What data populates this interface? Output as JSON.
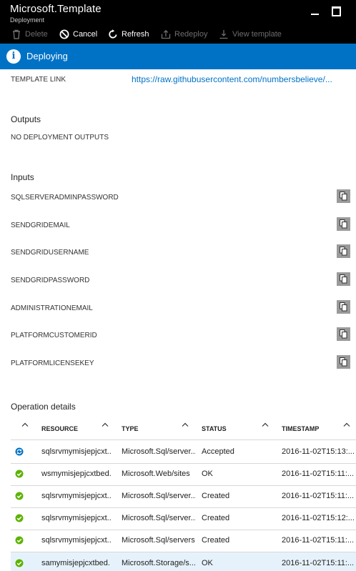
{
  "header": {
    "title": "Microsoft.Template",
    "subtitle": "Deployment"
  },
  "toolbar": {
    "delete_label": "Delete",
    "cancel_label": "Cancel",
    "refresh_label": "Refresh",
    "redeploy_label": "Redeploy",
    "view_template_label": "View template"
  },
  "banner": {
    "text": "Deploying",
    "color": "#0072c6"
  },
  "template_link": {
    "label": "TEMPLATE LINK",
    "url": "https://raw.githubusercontent.com/numbersbelieve/..."
  },
  "outputs": {
    "heading": "Outputs",
    "empty_text": "NO DEPLOYMENT OUTPUTS"
  },
  "inputs": {
    "heading": "Inputs",
    "items": [
      "SQLSERVERADMINPASSWORD",
      "SENDGRIDEMAIL",
      "SENDGRIDUSERNAME",
      "SENDGRIDPASSWORD",
      "ADMINISTRATIONEMAIL",
      "PLATFORMCUSTOMERID",
      "PLATFORMLICENSEKEY"
    ]
  },
  "operations": {
    "heading": "Operation details",
    "columns": [
      "RESOURCE",
      "TYPE",
      "STATUS",
      "TIMESTAMP"
    ],
    "rows": [
      {
        "icon": "in-progress-icon",
        "resource": "sqlsrvmymisjepjcxt...",
        "type": "Microsoft.Sql/server...",
        "status": "Accepted",
        "timestamp": "2016-11-02T15:13:..."
      },
      {
        "icon": "success-icon",
        "resource": "wsmymisjepjcxtbed...",
        "type": "Microsoft.Web/sites",
        "status": "OK",
        "timestamp": "2016-11-02T15:11:..."
      },
      {
        "icon": "success-icon",
        "resource": "sqlsrvmymisjepjcxt...",
        "type": "Microsoft.Sql/server...",
        "status": "Created",
        "timestamp": "2016-11-02T15:11:..."
      },
      {
        "icon": "success-icon",
        "resource": "sqlsrvmymisjepjcxt...",
        "type": "Microsoft.Sql/server...",
        "status": "Created",
        "timestamp": "2016-11-02T15:12:..."
      },
      {
        "icon": "success-icon",
        "resource": "sqlsrvmymisjepjcxt...",
        "type": "Microsoft.Sql/servers",
        "status": "Created",
        "timestamp": "2016-11-02T15:11:..."
      },
      {
        "icon": "success-icon",
        "resource": "samymisjepjcxtbed...",
        "type": "Microsoft.Storage/s...",
        "status": "OK",
        "timestamp": "2016-11-02T15:11:..."
      }
    ]
  },
  "colors": {
    "success": "#5db300",
    "in_progress": "#0072c6",
    "selected_row": "#e6f2fb"
  }
}
